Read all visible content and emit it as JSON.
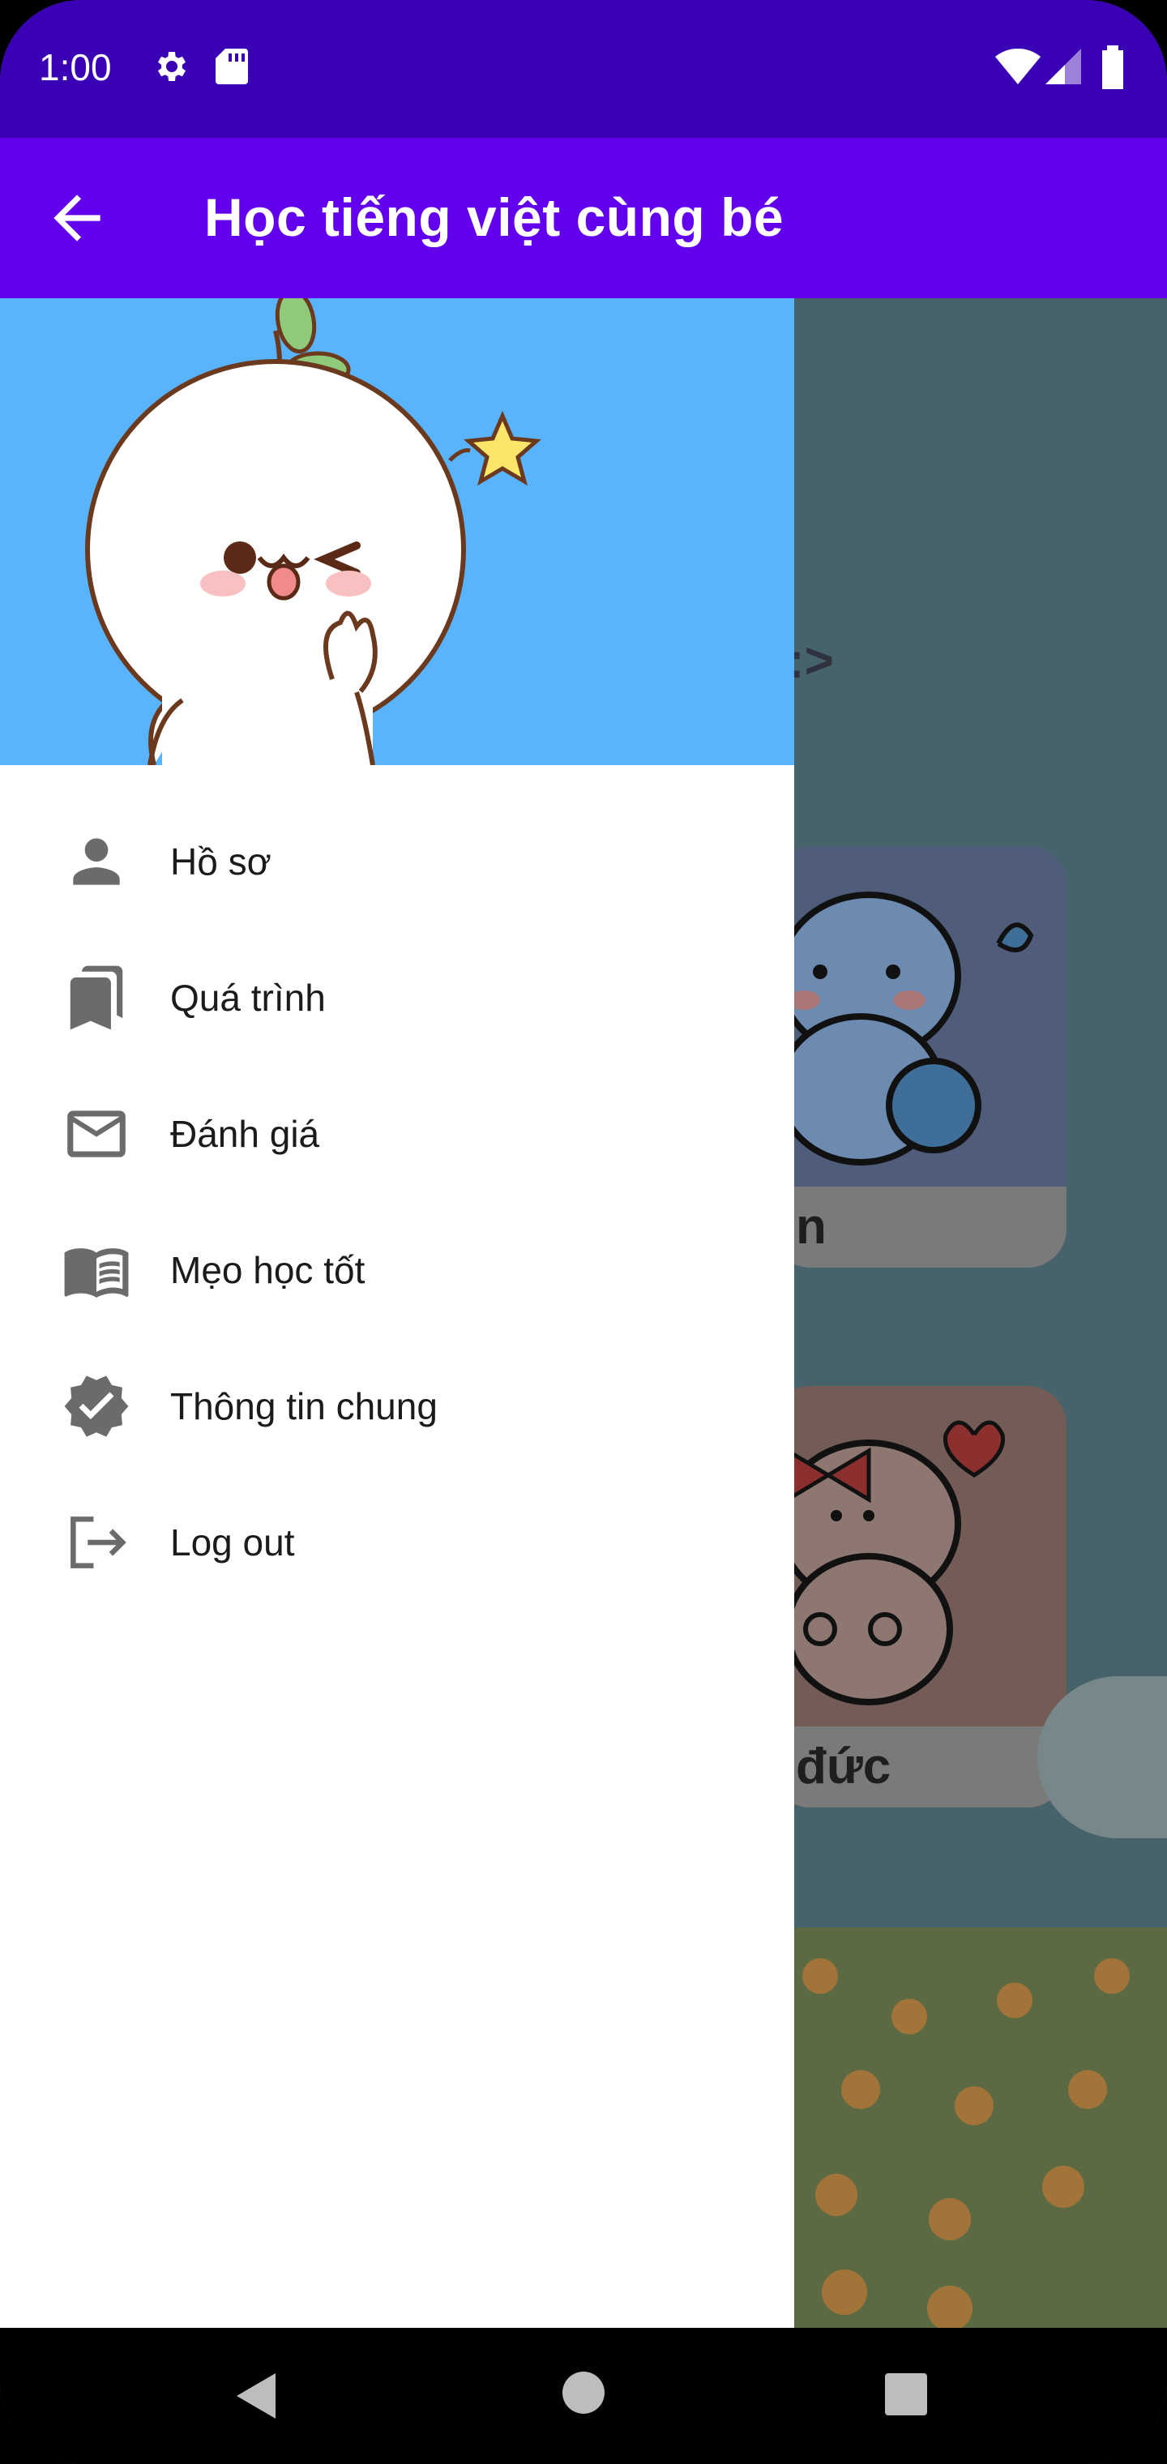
{
  "status_bar": {
    "time": "1:00",
    "icons": [
      "gear-icon",
      "sd-card-icon",
      "wifi-icon",
      "signal-icon",
      "battery-icon"
    ]
  },
  "app_bar": {
    "title": "Học tiếng việt cùng bé",
    "back_icon": "arrow-back-icon"
  },
  "drawer": {
    "header_image": "cute-mascot-illustration",
    "items": [
      {
        "label": "Hồ sơ",
        "icon": "person-icon"
      },
      {
        "label": "Quá trình",
        "icon": "bookmarks-icon"
      },
      {
        "label": "Đánh giá",
        "icon": "mail-icon"
      },
      {
        "label": "Mẹo học tốt",
        "icon": "book-icon"
      },
      {
        "label": "Thông tin chung",
        "icon": "verified-icon"
      },
      {
        "label": "Log out",
        "icon": "logout-icon"
      }
    ]
  },
  "background": {
    "partial_text": ":>",
    "cards": [
      {
        "label": "n"
      },
      {
        "label": "đức"
      }
    ]
  },
  "nav_bar": {
    "icons": [
      "back-triangle-icon",
      "home-circle-icon",
      "recents-square-icon"
    ]
  },
  "colors": {
    "status_bar": "#3a00b4",
    "app_bar": "#6200ee",
    "drawer_header": "#5ab4fc",
    "icon_gray": "#6b6b6b"
  }
}
